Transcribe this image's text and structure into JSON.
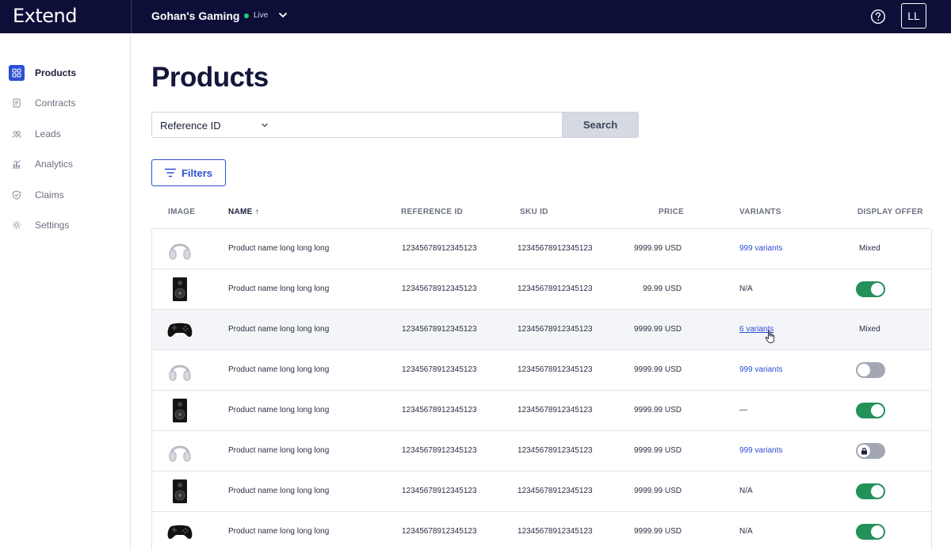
{
  "topbar": {
    "logo": "Extend",
    "store_name": "Gohan's Gaming",
    "status": "Live",
    "avatar_initials": "LL"
  },
  "sidebar": {
    "items": [
      {
        "label": "Products",
        "icon": "grid-icon",
        "active": true
      },
      {
        "label": "Contracts",
        "icon": "contract-icon",
        "active": false
      },
      {
        "label": "Leads",
        "icon": "leads-icon",
        "active": false
      },
      {
        "label": "Analytics",
        "icon": "analytics-icon",
        "active": false
      },
      {
        "label": "Claims",
        "icon": "shield-icon",
        "active": false
      },
      {
        "label": "Settings",
        "icon": "gear-icon",
        "active": false
      }
    ]
  },
  "main": {
    "title": "Products",
    "search": {
      "field_select": "Reference ID",
      "query": "",
      "button_label": "Search"
    },
    "filters_label": "Filters",
    "table": {
      "headers": {
        "image": "IMAGE",
        "name": "NAME",
        "reference_id": "REFERENCE ID",
        "sku_id": "SKU ID",
        "price": "PRICE",
        "variants": "VARIANTS",
        "display_offer": "DISPLAY OFFER"
      },
      "sort_indicator": "↑",
      "rows": [
        {
          "image": "headphones",
          "name": "Product name long long long",
          "reference_id": "12345678912345123",
          "sku_id": "12345678912345123",
          "price": "9999.99 USD",
          "variants": "999 variants",
          "variants_link": true,
          "display_offer": "Mixed"
        },
        {
          "image": "speaker",
          "name": "Product name long long long",
          "reference_id": "12345678912345123",
          "sku_id": "12345678912345123",
          "price": "99.99 USD",
          "variants": "N/A",
          "variants_link": false,
          "display_offer": "on"
        },
        {
          "image": "gamepad",
          "name": "Product name long long long",
          "reference_id": "12345678912345123",
          "sku_id": "12345678912345123",
          "price": "9999.99 USD",
          "variants": "6 variants",
          "variants_link": true,
          "display_offer": "Mixed"
        },
        {
          "image": "headphones",
          "name": "Product name long long long",
          "reference_id": "12345678912345123",
          "sku_id": "12345678912345123",
          "price": "9999.99 USD",
          "variants": "999 variants",
          "variants_link": true,
          "display_offer": "off"
        },
        {
          "image": "speaker",
          "name": "Product name long long long",
          "reference_id": "12345678912345123",
          "sku_id": "12345678912345123",
          "price": "9999.99 USD",
          "variants": "—",
          "variants_link": false,
          "display_offer": "on"
        },
        {
          "image": "headphones",
          "name": "Product name long long long",
          "reference_id": "12345678912345123",
          "sku_id": "12345678912345123",
          "price": "9999.99 USD",
          "variants": "999 variants",
          "variants_link": true,
          "display_offer": "locked"
        },
        {
          "image": "speaker",
          "name": "Product name long long long",
          "reference_id": "12345678912345123",
          "sku_id": "12345678912345123",
          "price": "9999.99 USD",
          "variants": "N/A",
          "variants_link": false,
          "display_offer": "on"
        },
        {
          "image": "gamepad",
          "name": "Product name long long long",
          "reference_id": "12345678912345123",
          "sku_id": "12345678912345123",
          "price": "9999.99 USD",
          "variants": "N/A",
          "variants_link": false,
          "display_offer": "on"
        }
      ]
    }
  },
  "colors": {
    "topbar_bg": "#0d0f38",
    "accent": "#2d4ed4",
    "toggle_on": "#23915a",
    "toggle_off": "#a2a7b3",
    "live": "#2ecc71"
  }
}
